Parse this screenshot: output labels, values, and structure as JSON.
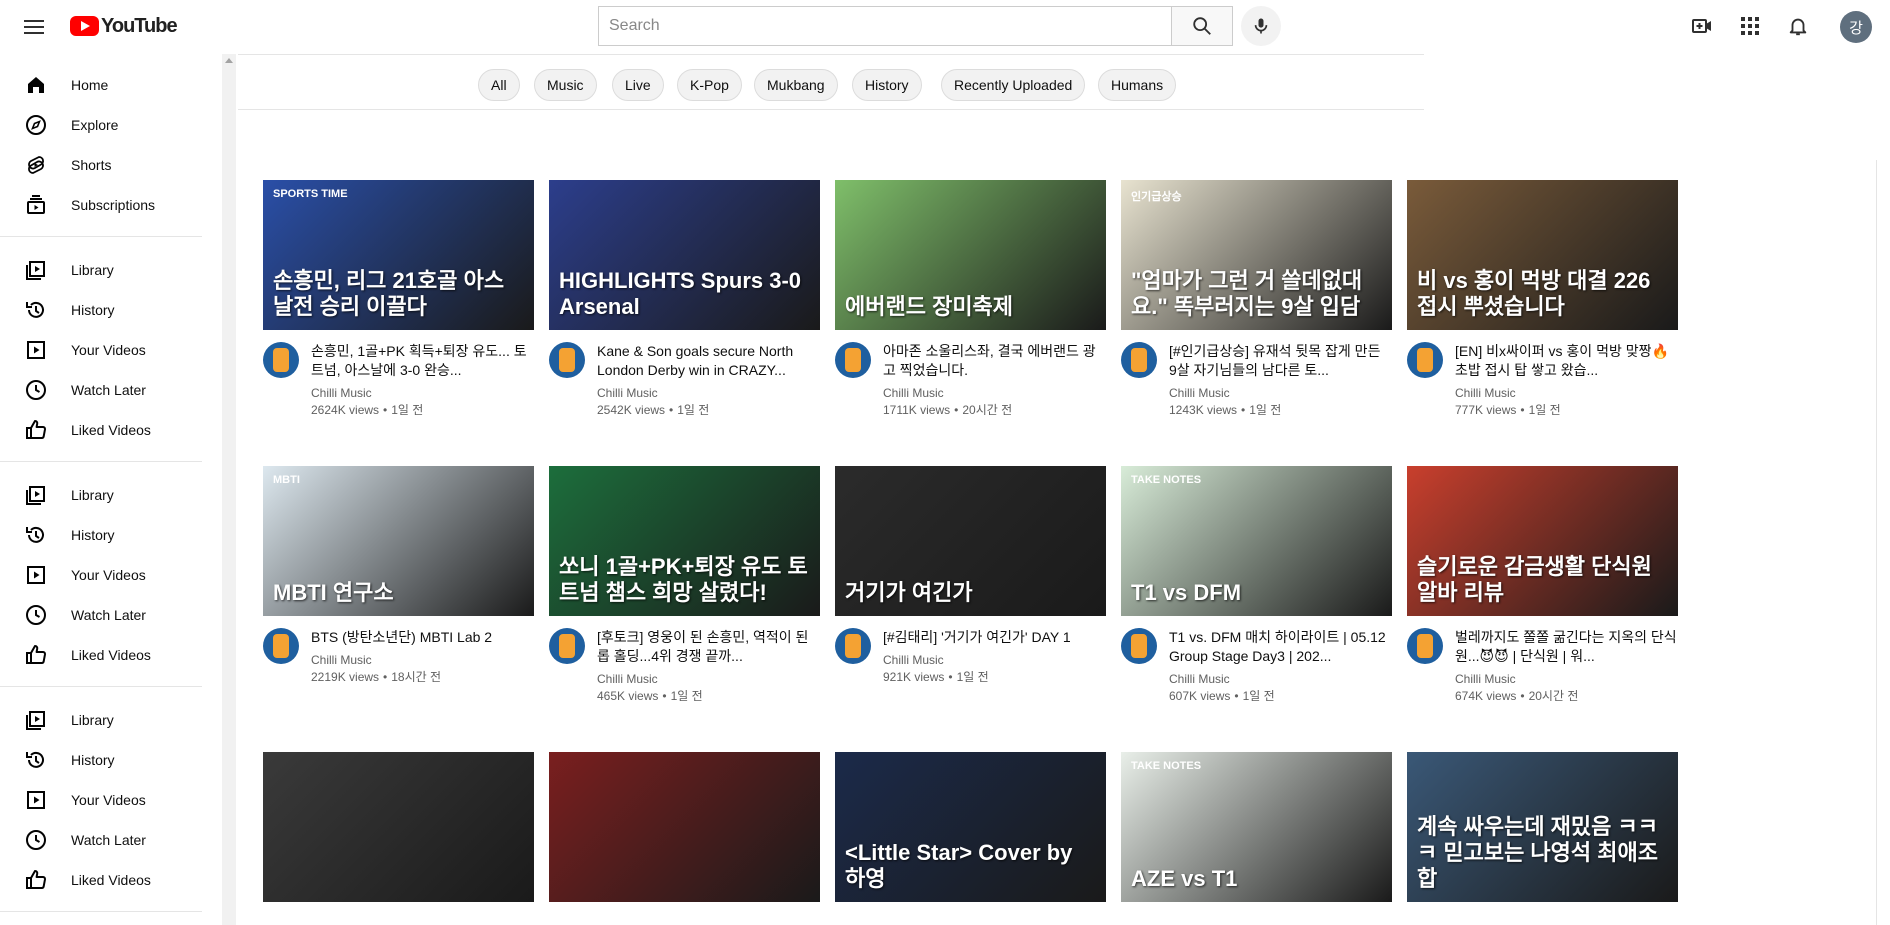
{
  "header": {
    "logo_text": "YouTube",
    "search_placeholder": "Search",
    "avatar_initial": "강"
  },
  "sidebar": {
    "items": [
      {
        "label": "Home",
        "icon": "home-icon"
      },
      {
        "label": "Explore",
        "icon": "compass-icon"
      },
      {
        "label": "Shorts",
        "icon": "shorts-icon"
      },
      {
        "label": "Subscriptions",
        "icon": "subscriptions-icon"
      },
      {
        "label": "Library",
        "icon": "library-icon"
      },
      {
        "label": "History",
        "icon": "history-icon"
      },
      {
        "label": "Your Videos",
        "icon": "play-icon"
      },
      {
        "label": "Watch Later",
        "icon": "clock-icon"
      },
      {
        "label": "Liked Videos",
        "icon": "thumbs-up-icon"
      },
      {
        "label": "Library",
        "icon": "library-icon"
      },
      {
        "label": "History",
        "icon": "history-icon"
      },
      {
        "label": "Your Videos",
        "icon": "play-icon"
      },
      {
        "label": "Watch Later",
        "icon": "clock-icon"
      },
      {
        "label": "Liked Videos",
        "icon": "thumbs-up-icon"
      },
      {
        "label": "Library",
        "icon": "library-icon"
      },
      {
        "label": "History",
        "icon": "history-icon"
      },
      {
        "label": "Your Videos",
        "icon": "play-icon"
      },
      {
        "label": "Watch Later",
        "icon": "clock-icon"
      },
      {
        "label": "Liked Videos",
        "icon": "thumbs-up-icon"
      }
    ]
  },
  "chips": [
    "All",
    "Music",
    "Live",
    "K-Pop",
    "Mukbang",
    "History",
    "Recently Uploaded",
    "Humans"
  ],
  "videos": [
    {
      "title": "손흥민, 1골+PK 획득+퇴장 유도... 토트넘, 아스날에 3-0 완승...",
      "channel": "Chilli Music",
      "views": "2624K views",
      "age": "1일 전",
      "thumb_caption": "손흥민, 리그 21호골 아스날전 승리 이끌다",
      "thumb_top": "SPORTS TIME"
    },
    {
      "title": "Kane & Son goals secure North London Derby win in CRAZY...",
      "channel": "Chilli Music",
      "views": "2542K views",
      "age": "1일 전",
      "thumb_caption": "HIGHLIGHTS Spurs 3-0 Arsenal",
      "thumb_top": ""
    },
    {
      "title": "아마존 소울리스좌, 결국 에버랜드 광고 찍었습니다.",
      "channel": "Chilli Music",
      "views": "1711K views",
      "age": "20시간 전",
      "thumb_caption": "에버랜드 장미축제",
      "thumb_top": ""
    },
    {
      "title": "[#인기급상승] 유재석 뒷목 잡게 만든 9살 자기님들의 남다른 토...",
      "channel": "Chilli Music",
      "views": "1243K views",
      "age": "1일 전",
      "thumb_caption": "\"엄마가 그런 거 쓸데없대요.\" 똑부러지는 9살 입담",
      "thumb_top": "인기급상승"
    },
    {
      "title": "[EN] 비x싸이퍼 vs 홍이 먹방 맞짱🔥 초밥 접시 탑 쌓고 왔습...",
      "channel": "Chilli Music",
      "views": "777K views",
      "age": "1일 전",
      "thumb_caption": "비 vs 홍이 먹방 대결 226접시 뿌셨습니다",
      "thumb_top": ""
    },
    {
      "title": "BTS (방탄소년단) MBTI Lab 2",
      "channel": "Chilli Music",
      "views": "2219K views",
      "age": "18시간 전",
      "thumb_caption": "MBTI 연구소",
      "thumb_top": "MBTI"
    },
    {
      "title": "[후토크] 영웅이 된 손흥민, 역적이 된 롭 홀딩...4위 경쟁 끝까...",
      "channel": "Chilli Music",
      "views": "465K views",
      "age": "1일 전",
      "thumb_caption": "쏘니 1골+PK+퇴장 유도 토트넘 챔스 희망 살렸다!",
      "thumb_top": ""
    },
    {
      "title": "[#김태리] '거기가 여긴가' DAY 1",
      "channel": "Chilli Music",
      "views": "921K views",
      "age": "1일 전",
      "thumb_caption": "거기가 여긴가",
      "thumb_top": ""
    },
    {
      "title": "T1 vs. DFM 매치 하이라이트 | 05.12 Group Stage Day3 | 202...",
      "channel": "Chilli Music",
      "views": "607K views",
      "age": "1일 전",
      "thumb_caption": "T1  vs  DFM",
      "thumb_top": "TAKE NOTES"
    },
    {
      "title": "벌레까지도 쫄쫄 굶긴다는 지옥의 단식원...😈😈 | 단식원 | 워...",
      "channel": "Chilli Music",
      "views": "674K views",
      "age": "20시간 전",
      "thumb_caption": "슬기로운 감금생활 단식원 알바 리뷰",
      "thumb_top": ""
    },
    {
      "title": "",
      "channel": "",
      "views": "",
      "age": "",
      "thumb_caption": "",
      "thumb_top": ""
    },
    {
      "title": "",
      "channel": "",
      "views": "",
      "age": "",
      "thumb_caption": "",
      "thumb_top": ""
    },
    {
      "title": "",
      "channel": "",
      "views": "",
      "age": "",
      "thumb_caption": "<Little Star> Cover by 하영",
      "thumb_top": ""
    },
    {
      "title": "",
      "channel": "",
      "views": "",
      "age": "",
      "thumb_caption": "AZE  vs  T1",
      "thumb_top": "TAKE NOTES"
    },
    {
      "title": "",
      "channel": "",
      "views": "",
      "age": "",
      "thumb_caption": "계속 싸우는데 재밌음 ㅋㅋㅋ 믿고보는 나영석 최애조합",
      "thumb_top": ""
    }
  ],
  "colors": {
    "brand_red": "#ff0000",
    "thumb_bg": [
      "#2a4fa8",
      "#2c3e8c",
      "#7fbf6a",
      "#e8e3d0",
      "#7a5b3a",
      "#dde8ef",
      "#1c6e3c",
      "#2b2b2b",
      "#d8ecd8",
      "#c93f2d",
      "#3a3a3a",
      "#7a1f1f",
      "#1b2a4a",
      "#e9efe9",
      "#3a5877"
    ]
  }
}
